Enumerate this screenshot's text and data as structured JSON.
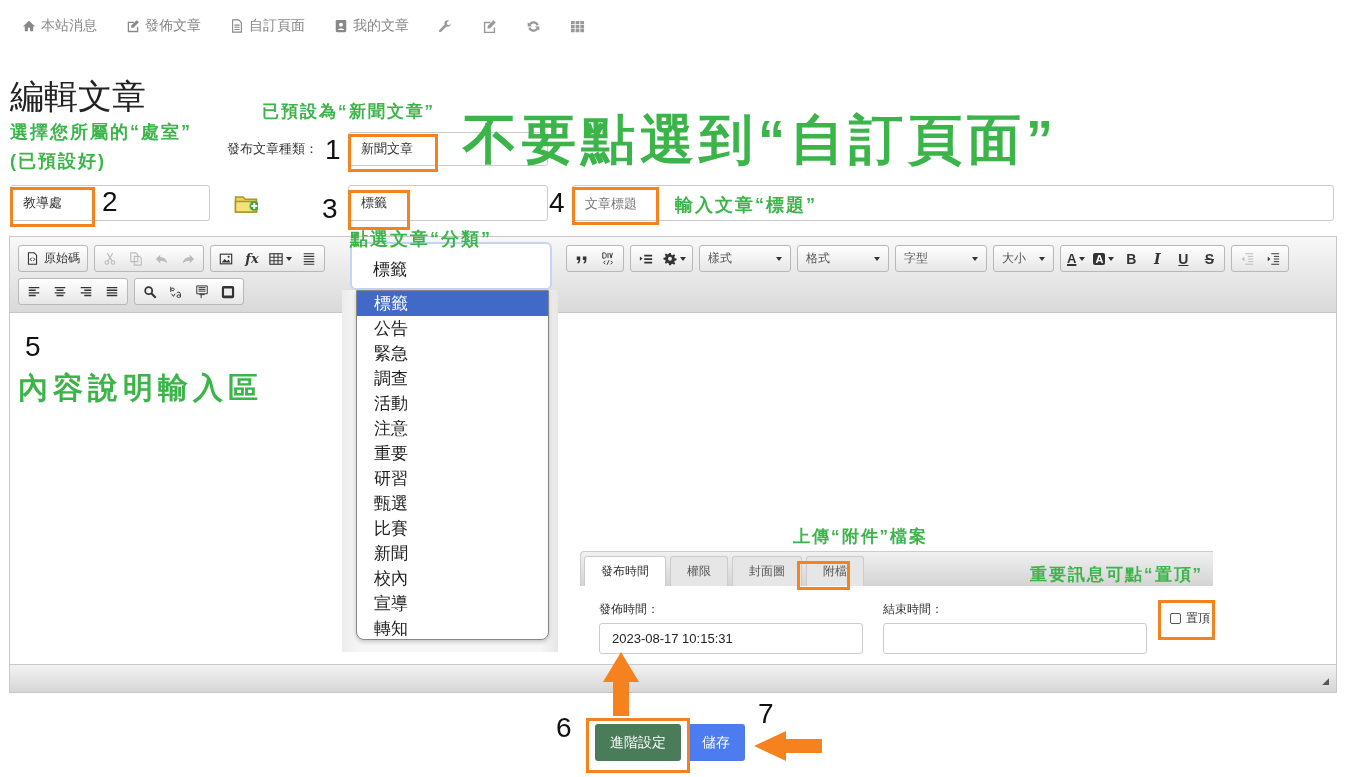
{
  "nav": {
    "links": [
      "本站消息",
      "發佈文章",
      "自訂頁面",
      "我的文章"
    ]
  },
  "page_title": "編輯文章",
  "form": {
    "type_label": "發布文章種類：",
    "type_value": "新聞文章",
    "department_value": "教導處",
    "category_value": "標籤",
    "title_placeholder": "文章標題"
  },
  "editor": {
    "source_button": "原始碼",
    "formula_glyph": "fx",
    "combos": [
      "樣式",
      "格式",
      "字型",
      "大小"
    ],
    "color_glyphs": [
      "A",
      "A"
    ],
    "style_glyphs": [
      "B",
      "I",
      "U",
      "S"
    ]
  },
  "category_dropdown": {
    "value": "標籤",
    "options": [
      {
        "label": "標籤",
        "selected": true
      },
      {
        "label": "公告",
        "selected": false
      },
      {
        "label": "緊急",
        "selected": false
      },
      {
        "label": "調查",
        "selected": false
      },
      {
        "label": "活動",
        "selected": false
      },
      {
        "label": "注意",
        "selected": false
      },
      {
        "label": "重要",
        "selected": false
      },
      {
        "label": "研習",
        "selected": false
      },
      {
        "label": "甄選",
        "selected": false
      },
      {
        "label": "比賽",
        "selected": false
      },
      {
        "label": "新聞",
        "selected": false
      },
      {
        "label": "校內",
        "selected": false
      },
      {
        "label": "宣導",
        "selected": false
      },
      {
        "label": "轉知",
        "selected": false
      }
    ]
  },
  "settings_tabs": [
    {
      "label": "發布時間",
      "selected": true
    },
    {
      "label": "權限",
      "selected": false
    },
    {
      "label": "封面圖",
      "selected": false
    },
    {
      "label": "附檔",
      "selected": false
    }
  ],
  "publish_time": {
    "label": "發佈時間：",
    "value": "2023-08-17 10:15:31"
  },
  "end_time": {
    "label": "結束時間："
  },
  "pin": {
    "label": "置頂",
    "checked": false
  },
  "buttons": [
    {
      "label": "進階設定",
      "kind": "advanced"
    },
    {
      "label": "儲存",
      "kind": "save"
    }
  ],
  "annotations": [
    {
      "kind": "note",
      "text": "選擇您所屬的“處室”"
    },
    {
      "kind": "note",
      "text": "(已預設好)"
    },
    {
      "kind": "note",
      "text": "已預設為“新聞文章”"
    },
    {
      "kind": "number",
      "text": "1"
    },
    {
      "kind": "headline",
      "text": "不要點選到“自訂頁面”"
    },
    {
      "kind": "number",
      "text": "2"
    },
    {
      "kind": "number",
      "text": "3"
    },
    {
      "kind": "number",
      "text": "4"
    },
    {
      "kind": "note",
      "text": "輸入文章“標題”"
    },
    {
      "kind": "note",
      "text": "點選文章“分類”"
    },
    {
      "kind": "number",
      "text": "5"
    },
    {
      "kind": "headline",
      "text": "內容說明輸入區"
    },
    {
      "kind": "note",
      "text": "上傳“附件”檔案"
    },
    {
      "kind": "note",
      "text": "重要訊息可點“置頂”"
    },
    {
      "kind": "number",
      "text": "7"
    },
    {
      "kind": "number",
      "text": "6"
    }
  ]
}
